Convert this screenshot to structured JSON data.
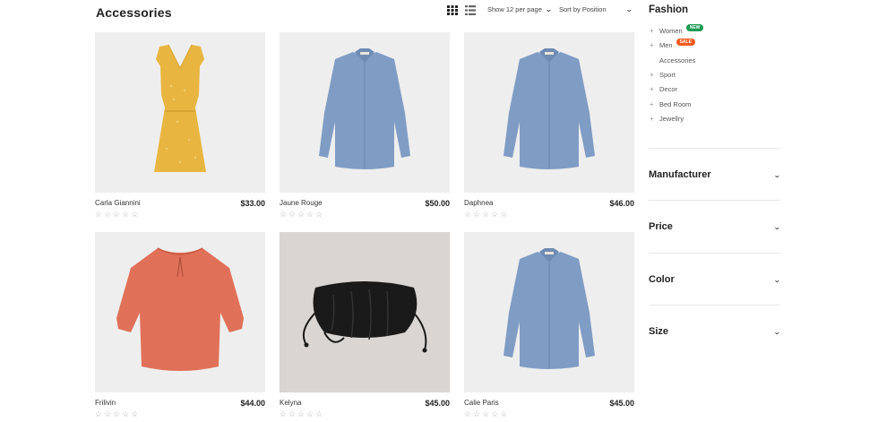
{
  "page": {
    "title": "Accessories"
  },
  "toolbar": {
    "grid_view_icon": "grid-icon",
    "list_view_icon": "list-icon",
    "per_page": "Show 12 per page",
    "sort": "Sort by Position"
  },
  "products": [
    {
      "name": "Carla Giannini",
      "price": "$33.00",
      "stars": "☆☆☆☆☆",
      "image": "yellow-dress"
    },
    {
      "name": "Jaune Rouge",
      "price": "$50.00",
      "stars": "☆☆☆☆☆",
      "image": "blue-shirt"
    },
    {
      "name": "Daphnea",
      "price": "$46.00",
      "stars": "☆☆☆☆☆",
      "image": "blue-shirt"
    },
    {
      "name": "Frilivin",
      "price": "$44.00",
      "stars": "☆☆☆☆☆",
      "image": "coral-blouse"
    },
    {
      "name": "Kelyna",
      "price": "$45.00",
      "stars": "☆☆☆☆☆",
      "image": "black-bag"
    },
    {
      "name": "Calie Paris",
      "price": "$45.00",
      "stars": "☆☆☆☆☆",
      "image": "blue-shirt"
    }
  ],
  "sidebar": {
    "title": "Fashion",
    "categories": [
      {
        "label": "Women",
        "badge": "NEW"
      },
      {
        "label": "Men",
        "badge": "SALE"
      },
      {
        "label": "Accessories"
      },
      {
        "label": "Sport"
      },
      {
        "label": "Decor"
      },
      {
        "label": "Bed Room"
      },
      {
        "label": "Jewellry"
      }
    ],
    "filters": [
      "Manufacturer",
      "Price",
      "Color",
      "Size"
    ]
  },
  "colors": {
    "new_badge": "#1b9a55",
    "sale_badge": "#f25a1d"
  }
}
